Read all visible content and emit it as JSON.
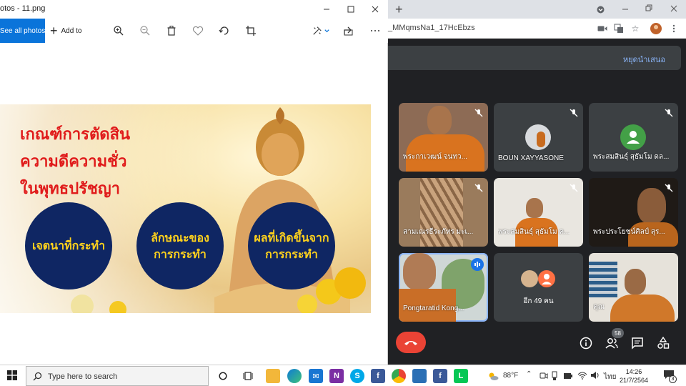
{
  "photos": {
    "title": "otos - 11.png",
    "see_all_label": "See all photos",
    "add_to_label": "Add to",
    "icons": [
      "zoom-in-icon",
      "zoom-out-icon",
      "delete-icon",
      "heart-icon",
      "rotate-icon",
      "crop-icon",
      "edit-icon",
      "share-icon",
      "more-icon"
    ]
  },
  "slide": {
    "title_lines": [
      "เกณฑ์การตัดสิน",
      "ความดีความชั่ว",
      "ในพุทธปรัชญา"
    ],
    "circles": [
      {
        "line1": "เจตนาที่กระทำ",
        "line2": ""
      },
      {
        "line1": "ลักษณะของ",
        "line2": "การกระทำ"
      },
      {
        "line1": "ผลที่เกิดขึ้นจาก",
        "line2": "การกระทำ"
      }
    ],
    "colors": {
      "title": "#e01b1b",
      "circle_fill": "#0f2663",
      "circle_text": "#ffd21c"
    }
  },
  "chrome": {
    "url_fragment": "_MMqmsNa1_17HcEbzs",
    "stop_presenting_label": "หยุดนำเสนอ"
  },
  "meet": {
    "participants": [
      {
        "name": "พระกาเวฒน์ จนทว...",
        "muted": true
      },
      {
        "name": "BOUN XAYYASONE",
        "muted": true
      },
      {
        "name": "พระสมสินธุ์ สุธัมโม ดล...",
        "muted": true
      },
      {
        "name": "สามเณรธีระภัทร มะเ...",
        "muted": true
      },
      {
        "name": "พระสมสินธุ์ สุธัมโม ค...",
        "muted": true
      },
      {
        "name": "พระประโยชน์ศิลป์ สุร...",
        "muted": true
      },
      {
        "name": "Pongtaratid Kong...",
        "muted": false,
        "speaking": true
      },
      {
        "name": "อีก 49 คน",
        "muted": false
      },
      {
        "name": "คุณ",
        "muted": false
      }
    ],
    "participant_count": "58",
    "accent_color": "#8ab4f8"
  },
  "taskbar": {
    "search_placeholder": "Type here to search",
    "weather": "88°F",
    "language": "ไทย",
    "time": "14:26",
    "date": "21/7/2564",
    "notification_count": "3"
  }
}
